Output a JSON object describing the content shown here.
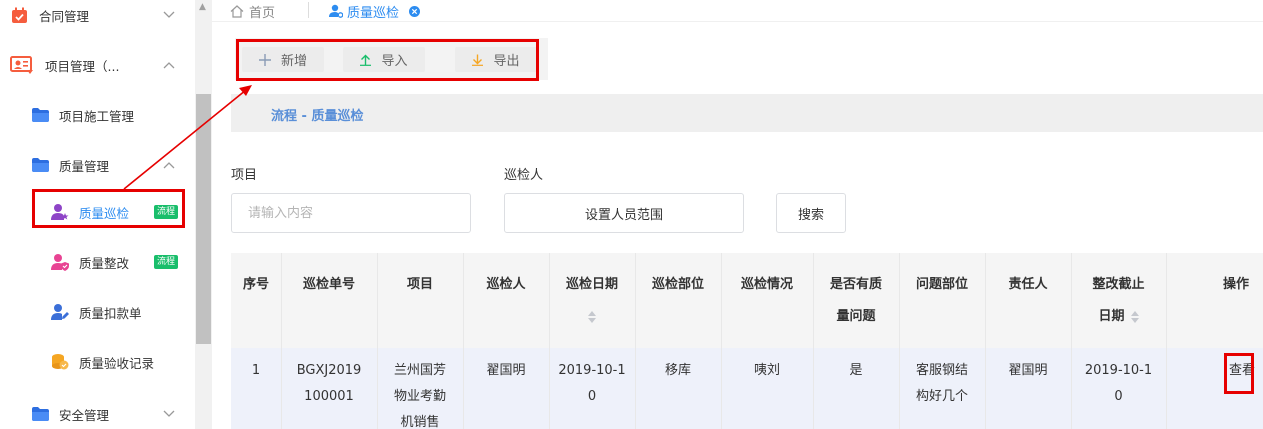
{
  "sidebar": {
    "items": [
      {
        "label": "合同管理",
        "icon": "calendar-icon"
      },
      {
        "label": "项目管理（...",
        "icon": "project-board-icon"
      },
      {
        "label": "项目施工管理",
        "icon": "folder-icon"
      },
      {
        "label": "质量管理",
        "icon": "folder-icon"
      },
      {
        "label": "质量巡检",
        "icon": "user-star-icon",
        "badge": "流程"
      },
      {
        "label": "质量整改",
        "icon": "user-shield-icon",
        "badge": "流程"
      },
      {
        "label": "质量扣款单",
        "icon": "user-edit-icon"
      },
      {
        "label": "质量验收记录",
        "icon": "coins-icon"
      },
      {
        "label": "安全管理",
        "icon": "folder-icon"
      }
    ]
  },
  "tabs": {
    "home": "首页",
    "current": "质量巡检"
  },
  "toolbar": {
    "add_label": "新增",
    "import_label": "导入",
    "export_label": "导出"
  },
  "flow_title": "流程 - 质量巡检",
  "filters": {
    "project_label": "项目",
    "project_placeholder": "请输入内容",
    "inspector_label": "巡检人",
    "inspector_button": "设置人员范围",
    "search_button": "搜索"
  },
  "table": {
    "headers": {
      "seq": "序号",
      "order_no": "巡检单号",
      "project": "项目",
      "inspector": "巡检人",
      "date_a": "巡检日期",
      "part": "巡检部位",
      "situation": "巡检情况",
      "has_issue_a": "是否有质",
      "has_issue_b": "量问题",
      "issue_part": "问题部位",
      "owner": "责任人",
      "deadline_a": "整改截止",
      "deadline_b": "日期",
      "action": "操作"
    },
    "rows": [
      {
        "seq": "1",
        "order_no_a": "BGXJ2019",
        "order_no_b": "100001",
        "project_a": "兰州国芳",
        "project_b": "物业考勤",
        "project_c": "机销售",
        "inspector": "翟国明",
        "date_a": "2019-10-1",
        "date_b": "0",
        "part": "移库",
        "situation": "咦刘",
        "has_issue": "是",
        "issue_part_a": "客服钢结",
        "issue_part_b": "构好几个",
        "owner": "翟国明",
        "deadline_a": "2019-10-1",
        "deadline_b": "0",
        "action": "查看"
      }
    ]
  },
  "colors": {
    "accent": "#2d8cf0",
    "badge": "#19be6b",
    "highlight": "#e60000"
  }
}
